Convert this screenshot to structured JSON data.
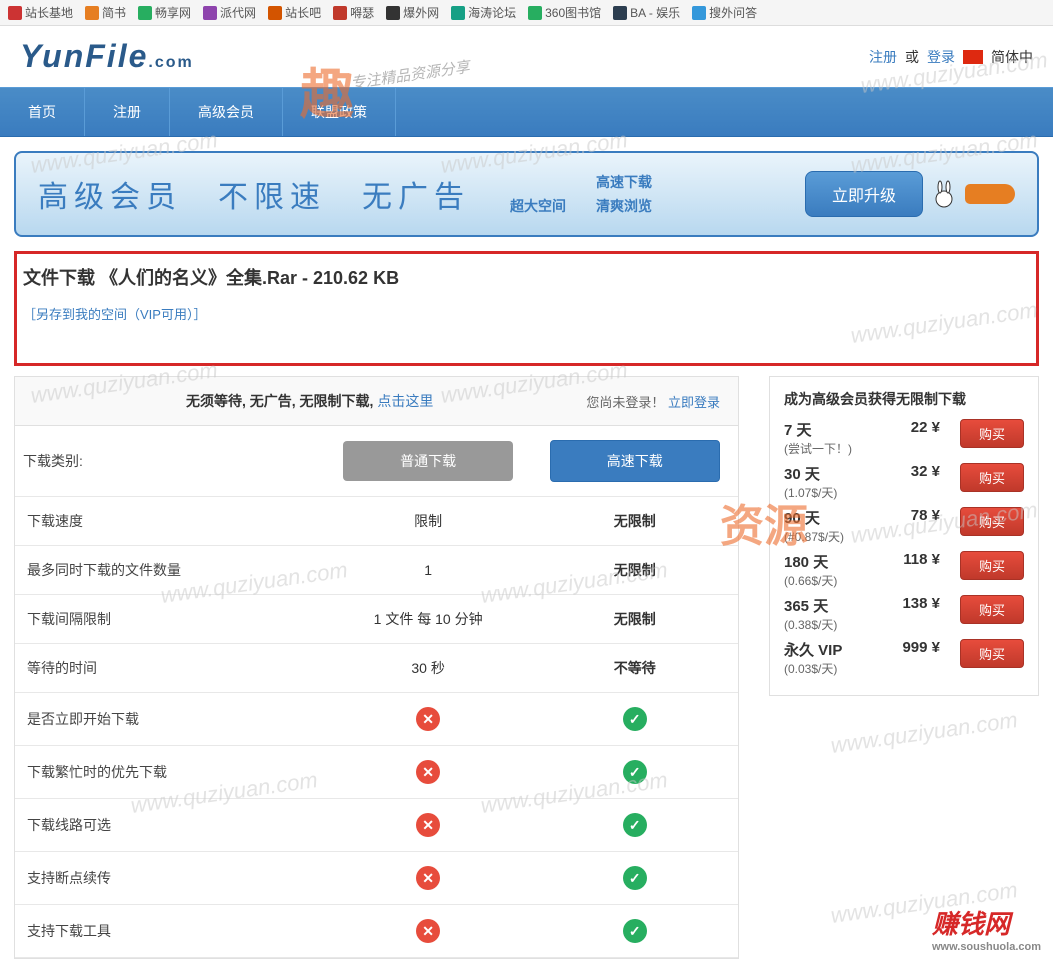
{
  "bookmarks": [
    "站长基地",
    "简书",
    "畅享网",
    "派代网",
    "站长吧",
    "嘚瑟",
    "爆外网",
    "海涛论坛",
    "360图书馆",
    "BA - 娱乐",
    "搜外问答"
  ],
  "logo": {
    "name": "YunFile",
    "suffix": ".com"
  },
  "header": {
    "register": "注册",
    "or": "或",
    "login": "登录",
    "lang": "简体中"
  },
  "nav": [
    "首页",
    "注册",
    "高级会员",
    "联盟政策"
  ],
  "banner": {
    "text": "高级会员　不限速　无广告",
    "pills_top": "高速下载",
    "pill_l": "超大空间",
    "pill_r": "清爽浏览",
    "btn": "立即升级"
  },
  "file": {
    "title": "文件下载 《人们的名义》全集.Rar - 210.62 KB",
    "save": "［另存到我的空间（VIP可用）］"
  },
  "toprow": {
    "left_prefix": "无须等待, 无广告, 无限制下载, ",
    "left_link": "点击这里",
    "right_prefix": "您尚未登录！ ",
    "right_link": "立即登录"
  },
  "buttons": {
    "label": "下载类别:",
    "normal": "普通下载",
    "fast": "高速下载"
  },
  "rows": [
    {
      "label": "下载速度",
      "c1": "限制",
      "c2": "无限制",
      "bold": true
    },
    {
      "label": "最多同时下载的文件数量",
      "c1": "1",
      "c2": "无限制",
      "bold": true
    },
    {
      "label": "下载间隔限制",
      "c1": "1 文件 每 10 分钟",
      "c2": "无限制",
      "bold": true
    },
    {
      "label": "等待的时间",
      "c1": "30 秒",
      "c2": "不等待",
      "bold": true
    },
    {
      "label": "是否立即开始下载",
      "c1": "x",
      "c2": "v"
    },
    {
      "label": "下载繁忙时的优先下载",
      "c1": "x",
      "c2": "v"
    },
    {
      "label": "下载线路可选",
      "c1": "x",
      "c2": "v"
    },
    {
      "label": "支持断点续传",
      "c1": "x",
      "c2": "v"
    },
    {
      "label": "支持下载工具",
      "c1": "x",
      "c2": "v"
    }
  ],
  "vip": {
    "title": "成为高级会员获得无限制下载",
    "buy": "购买",
    "plans": [
      {
        "name": "7 天",
        "sub": "(尝试一下！)",
        "price": "22 ¥"
      },
      {
        "name": "30 天",
        "sub": "(1.07$/天)",
        "price": "32 ¥"
      },
      {
        "name": "90 天",
        "sub": "(#0.87$/天)",
        "price": "78 ¥"
      },
      {
        "name": "180 天",
        "sub": "(0.66$/天)",
        "price": "118 ¥"
      },
      {
        "name": "365 天",
        "sub": "(0.38$/天)",
        "price": "138 ¥"
      },
      {
        "name": "永久 VIP",
        "sub": "(0.03$/天)",
        "price": "999 ¥"
      }
    ]
  },
  "watermarks": {
    "text": "www.quziyuan.com",
    "qu": "趣",
    "qusub": "专注精品资源分享",
    "ziyuan": "资源",
    "foot": "赚钱网",
    "foot_sub": "www.soushuola.com"
  }
}
